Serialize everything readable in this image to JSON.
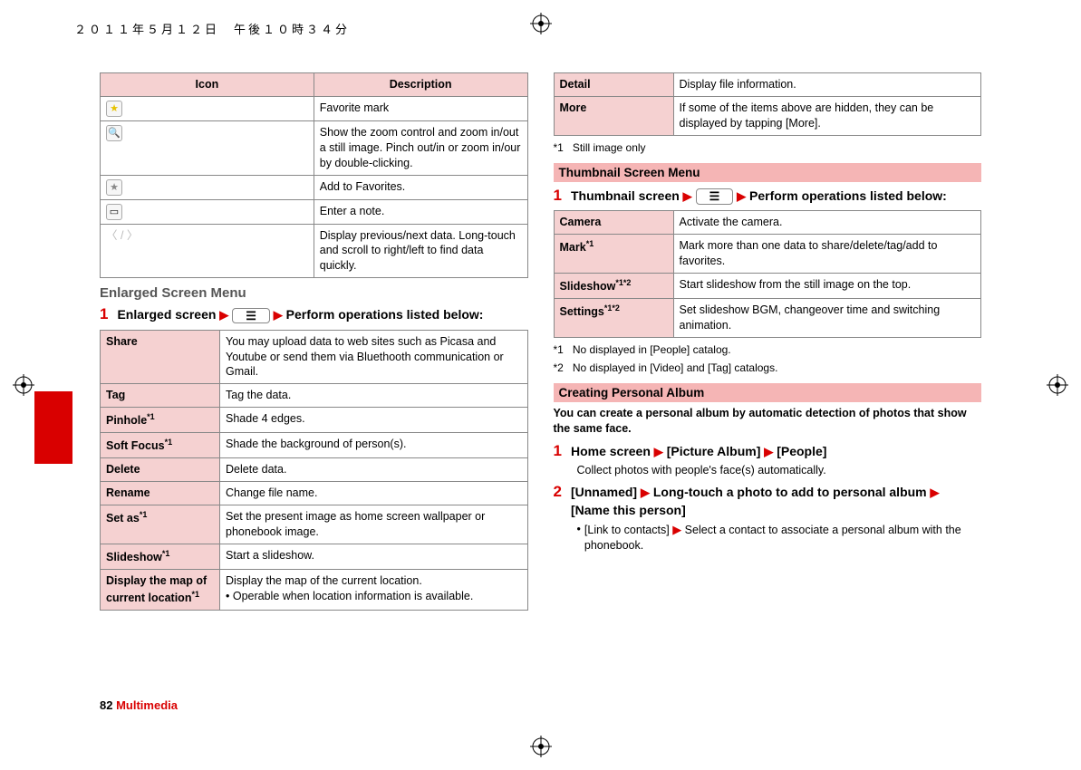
{
  "header_timestamp": "２０１１年５月１２日　午後１０時３４分",
  "left": {
    "icon_table": {
      "headers": [
        "Icon",
        "Description"
      ],
      "rows": [
        {
          "icon_name": "favorite-mark-icon",
          "icon_glyph": "★",
          "desc": "Favorite mark"
        },
        {
          "icon_name": "zoom-icon",
          "icon_glyph": "🔍",
          "desc": "Show the zoom control and zoom in/out a still image. Pinch out/in or zoom in/our by double-clicking."
        },
        {
          "icon_name": "add-favorite-icon",
          "icon_glyph": "★",
          "desc": "Add to Favorites."
        },
        {
          "icon_name": "note-icon",
          "icon_glyph": "▭",
          "desc": "Enter a note."
        },
        {
          "icon_name": "prev-next-icon",
          "icon_glyph": "〈 / 〉",
          "desc": "Display previous/next data. Long-touch and scroll to right/left to find data quickly."
        }
      ]
    },
    "enlarged_heading": "Enlarged Screen Menu",
    "enlarged_step_num": "1",
    "enlarged_step_pre": "Enlarged screen",
    "enlarged_step_post": "Perform operations listed below:",
    "menu_icon_glyph": "☰",
    "enlarged_table": [
      {
        "label": "Share",
        "desc": "You may upload data to web sites such as Picasa and Youtube or send them via Bluethooth communication or Gmail."
      },
      {
        "label": "Tag",
        "desc": "Tag the data."
      },
      {
        "label": "Pinhole*1",
        "label_plain": "Pinhole",
        "sup": "*1",
        "desc": "Shade 4 edges."
      },
      {
        "label": "Soft Focus*1",
        "label_plain": "Soft Focus",
        "sup": "*1",
        "desc": "Shade the background of person(s)."
      },
      {
        "label": "Delete",
        "desc": "Delete data."
      },
      {
        "label": "Rename",
        "desc": "Change file name."
      },
      {
        "label": "Set as*1",
        "label_plain": "Set as",
        "sup": "*1",
        "desc": "Set the present image as home screen wallpaper or phonebook image."
      },
      {
        "label": "Slideshow*1",
        "label_plain": "Slideshow",
        "sup": "*1",
        "desc": "Start a slideshow."
      },
      {
        "label": "Display the map of current location*1",
        "label_plain": "Display the map of current location",
        "sup": "*1",
        "desc": "Display the map of the current location.\n• Operable when location information is available."
      }
    ]
  },
  "right": {
    "top_table": [
      {
        "label": "Detail",
        "desc": "Display file information."
      },
      {
        "label": "More",
        "desc": "If some of the items above are hidden, they can be displayed by tapping [More]."
      }
    ],
    "footnote_top": {
      "key": "*1",
      "text": "Still image only"
    },
    "thumb_heading": "Thumbnail Screen Menu",
    "thumb_step_num": "1",
    "thumb_step_pre": "Thumbnail screen",
    "thumb_step_post": "Perform operations listed below:",
    "menu_icon_glyph": "☰",
    "thumb_table": [
      {
        "label": "Camera",
        "desc": "Activate the camera."
      },
      {
        "label_plain": "Mark",
        "sup": "*1",
        "desc": "Mark more than one data to share/delete/tag/add to favorites."
      },
      {
        "label_plain": "Slideshow",
        "sup": "*1*2",
        "desc": "Start slideshow from the still image on the top."
      },
      {
        "label_plain": "Settings",
        "sup": "*1*2",
        "desc": "Set slideshow BGM, changeover time and switching animation."
      }
    ],
    "footnotes": [
      {
        "key": "*1",
        "text": "No displayed in [People] catalog."
      },
      {
        "key": "*2",
        "text": "No displayed in [Video] and [Tag] catalogs."
      }
    ],
    "album_heading": "Creating Personal Album",
    "album_intro": "You can create a personal album by automatic detection of photos that show the same face.",
    "album_step1_num": "1",
    "album_step1_a": "Home screen",
    "album_step1_b": "[Picture Album]",
    "album_step1_c": "[People]",
    "album_step1_sub": "Collect photos with people's face(s) automatically.",
    "album_step2_num": "2",
    "album_step2_a": "[Unnamed]",
    "album_step2_b": "Long-touch a photo to add to personal album",
    "album_step2_c": "[Name this person]",
    "album_step2_bullet_a": "[Link to contacts]",
    "album_step2_bullet_b": "Select a contact to associate a personal album with the phonebook."
  },
  "footer": {
    "page": "82",
    "section": "Multimedia"
  }
}
